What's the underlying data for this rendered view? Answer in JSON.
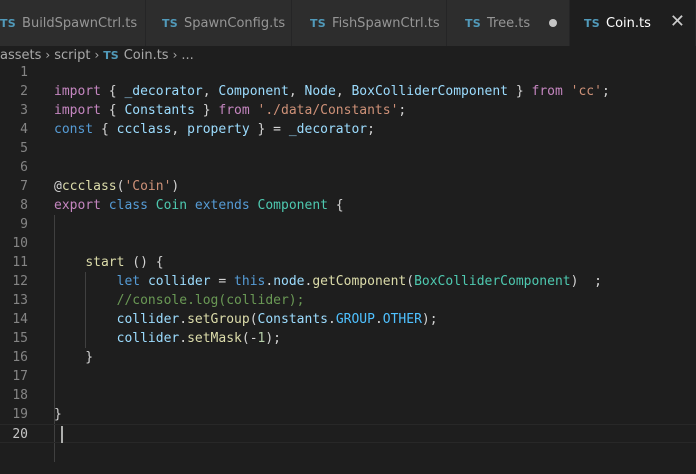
{
  "tabs": [
    {
      "badge": "TS",
      "label": "BuildSpawnCtrl.ts"
    },
    {
      "badge": "TS",
      "label": "SpawnConfig.ts"
    },
    {
      "badge": "TS",
      "label": "FishSpawnCtrl.ts"
    },
    {
      "badge": "TS",
      "label": "Tree.ts",
      "modified_indicator": "dot"
    },
    {
      "badge": "TS",
      "label": "Coin.ts",
      "active": true,
      "close_glyph": "✕"
    }
  ],
  "breadcrumb": {
    "segments": [
      "assets",
      "script",
      "Coin.ts",
      "..."
    ],
    "file_badge": "TS",
    "separator": "›"
  },
  "editor": {
    "line_numbers": [
      "1",
      "2",
      "3",
      "4",
      "5",
      "6",
      "7",
      "8",
      "9",
      "10",
      "11",
      "12",
      "13",
      "14",
      "15",
      "16",
      "17",
      "18",
      "19",
      "20"
    ],
    "current_line": "20",
    "lines": [
      [],
      [
        [
          "kw",
          "import"
        ],
        [
          "pn",
          " { "
        ],
        [
          "var",
          "_decorator"
        ],
        [
          "pn",
          ", "
        ],
        [
          "var",
          "Component"
        ],
        [
          "pn",
          ", "
        ],
        [
          "var",
          "Node"
        ],
        [
          "pn",
          ", "
        ],
        [
          "var",
          "BoxColliderComponent"
        ],
        [
          "pn",
          " } "
        ],
        [
          "kw",
          "from"
        ],
        [
          "pn",
          " "
        ],
        [
          "str",
          "'cc'"
        ],
        [
          "pn",
          ";"
        ]
      ],
      [
        [
          "kw",
          "import"
        ],
        [
          "pn",
          " { "
        ],
        [
          "var",
          "Constants"
        ],
        [
          "pn",
          " } "
        ],
        [
          "kw",
          "from"
        ],
        [
          "pn",
          " "
        ],
        [
          "str",
          "'./data/Constants'"
        ],
        [
          "pn",
          ";"
        ]
      ],
      [
        [
          "sk",
          "const"
        ],
        [
          "pn",
          " { "
        ],
        [
          "var",
          "ccclass"
        ],
        [
          "pn",
          ", "
        ],
        [
          "var",
          "property"
        ],
        [
          "pn",
          " } = "
        ],
        [
          "var",
          "_decorator"
        ],
        [
          "pn",
          ";"
        ]
      ],
      [],
      [],
      [
        [
          "pn",
          "@"
        ],
        [
          "fn",
          "ccclass"
        ],
        [
          "pn",
          "("
        ],
        [
          "str",
          "'Coin'"
        ],
        [
          "pn",
          ")"
        ]
      ],
      [
        [
          "kw",
          "export"
        ],
        [
          "pn",
          " "
        ],
        [
          "sk",
          "class"
        ],
        [
          "pn",
          " "
        ],
        [
          "ty",
          "Coin"
        ],
        [
          "pn",
          " "
        ],
        [
          "sk",
          "extends"
        ],
        [
          "pn",
          " "
        ],
        [
          "ty",
          "Component"
        ],
        [
          "pn",
          " {"
        ]
      ],
      [],
      [],
      [
        [
          "pn",
          "    "
        ],
        [
          "fn",
          "start"
        ],
        [
          "pn",
          " () {"
        ]
      ],
      [
        [
          "pn",
          "        "
        ],
        [
          "sk",
          "let"
        ],
        [
          "pn",
          " "
        ],
        [
          "var",
          "collider"
        ],
        [
          "pn",
          " = "
        ],
        [
          "sk",
          "this"
        ],
        [
          "pn",
          "."
        ],
        [
          "var",
          "node"
        ],
        [
          "pn",
          "."
        ],
        [
          "fn",
          "getComponent"
        ],
        [
          "pn",
          "("
        ],
        [
          "ty",
          "BoxColliderComponent"
        ],
        [
          "pn",
          ")  ;"
        ]
      ],
      [
        [
          "pn",
          "        "
        ],
        [
          "cm",
          "//console.log(collider);"
        ]
      ],
      [
        [
          "pn",
          "        "
        ],
        [
          "var",
          "collider"
        ],
        [
          "pn",
          "."
        ],
        [
          "fn",
          "setGroup"
        ],
        [
          "pn",
          "("
        ],
        [
          "var",
          "Constants"
        ],
        [
          "pn",
          "."
        ],
        [
          "ct",
          "GROUP"
        ],
        [
          "pn",
          "."
        ],
        [
          "ct",
          "OTHER"
        ],
        [
          "pn",
          ");"
        ]
      ],
      [
        [
          "pn",
          "        "
        ],
        [
          "var",
          "collider"
        ],
        [
          "pn",
          "."
        ],
        [
          "fn",
          "setMask"
        ],
        [
          "pn",
          "(-"
        ],
        [
          "num",
          "1"
        ],
        [
          "pn",
          ");"
        ]
      ],
      [
        [
          "pn",
          "    }"
        ]
      ],
      [],
      [],
      [
        [
          "pn",
          "}"
        ]
      ],
      []
    ]
  },
  "colors": {
    "background": "#1e1e1e",
    "tab_inactive": "#2d2d2d",
    "ts_badge": "#519aba",
    "keyword": "#c586c0",
    "storage": "#569cd6",
    "variable": "#9cdcfe",
    "type": "#4ec9b0",
    "function": "#dcdcaa",
    "string": "#ce9178",
    "comment": "#6a9955"
  }
}
